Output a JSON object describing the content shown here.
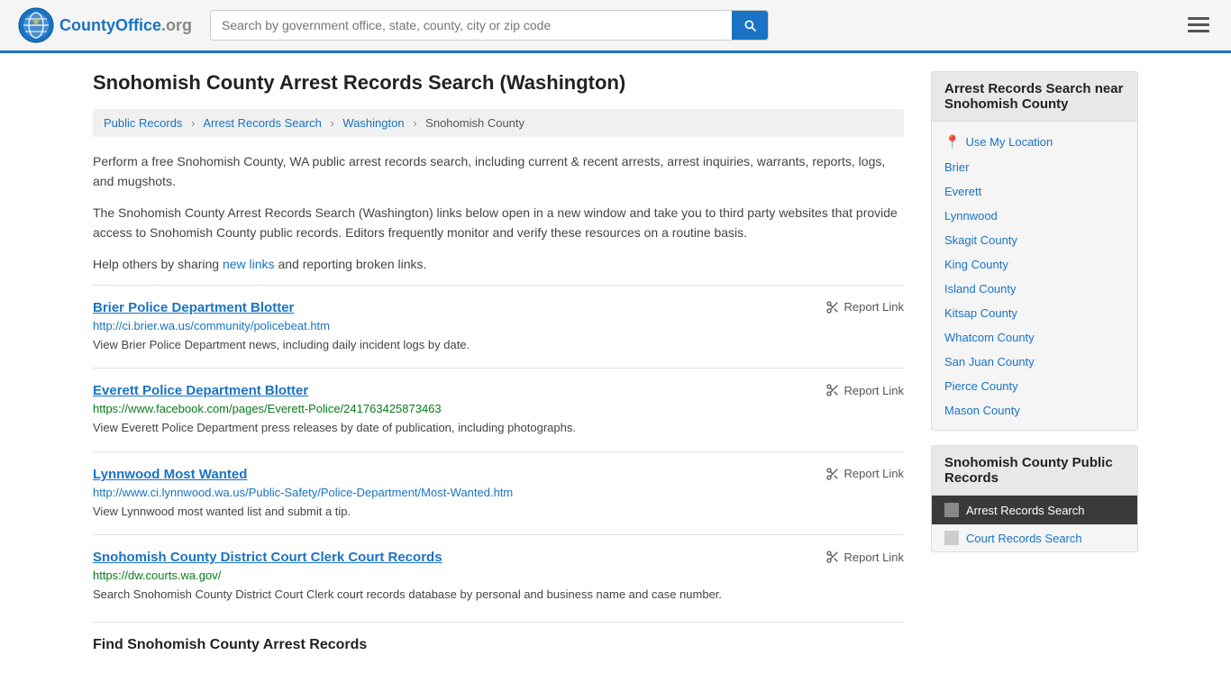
{
  "header": {
    "logo_text": "CountyOffice",
    "logo_suffix": ".org",
    "search_placeholder": "Search by government office, state, county, city or zip code"
  },
  "page": {
    "title": "Snohomish County Arrest Records Search (Washington)"
  },
  "breadcrumb": {
    "items": [
      {
        "label": "Public Records",
        "href": "#"
      },
      {
        "label": "Arrest Records Search",
        "href": "#"
      },
      {
        "label": "Washington",
        "href": "#"
      },
      {
        "label": "Snohomish County",
        "href": "#"
      }
    ]
  },
  "description": [
    "Perform a free Snohomish County, WA public arrest records search, including current & recent arrests, arrest inquiries, warrants, reports, logs, and mugshots.",
    "The Snohomish County Arrest Records Search (Washington) links below open in a new window and take you to third party websites that provide access to Snohomish County public records. Editors frequently monitor and verify these resources on a routine basis.",
    "Help others by sharing new links and reporting broken links."
  ],
  "resources": [
    {
      "title": "Brier Police Department Blotter",
      "url": "http://ci.brier.wa.us/community/policebeat.htm",
      "url_color": "blue",
      "desc": "View Brier Police Department news, including daily incident logs by date."
    },
    {
      "title": "Everett Police Department Blotter",
      "url": "https://www.facebook.com/pages/Everett-Police/241763425873463",
      "url_color": "green",
      "desc": "View Everett Police Department press releases by date of publication, including photographs."
    },
    {
      "title": "Lynnwood Most Wanted",
      "url": "http://www.ci.lynnwood.wa.us/Public-Safety/Police-Department/Most-Wanted.htm",
      "url_color": "blue",
      "desc": "View Lynnwood most wanted list and submit a tip."
    },
    {
      "title": "Snohomish County District Court Clerk Court Records",
      "url": "https://dw.courts.wa.gov/",
      "url_color": "green",
      "desc": "Search Snohomish County District Court Clerk court records database by personal and business name and case number."
    }
  ],
  "report_link_label": "Report Link",
  "section_heading": "Find Snohomish County Arrest Records",
  "sidebar": {
    "nearby_title": "Arrest Records Search near Snohomish County",
    "use_my_location": "Use My Location",
    "nearby_links": [
      "Brier",
      "Everett",
      "Lynnwood",
      "Skagit County",
      "King County",
      "Island County",
      "Kitsap County",
      "Whatcom County",
      "San Juan County",
      "Pierce County",
      "Mason County"
    ],
    "public_records_title": "Snohomish County Public Records",
    "public_records_links": [
      {
        "label": "Arrest Records Search",
        "active": true
      },
      {
        "label": "Court Records Search",
        "active": false
      }
    ]
  }
}
